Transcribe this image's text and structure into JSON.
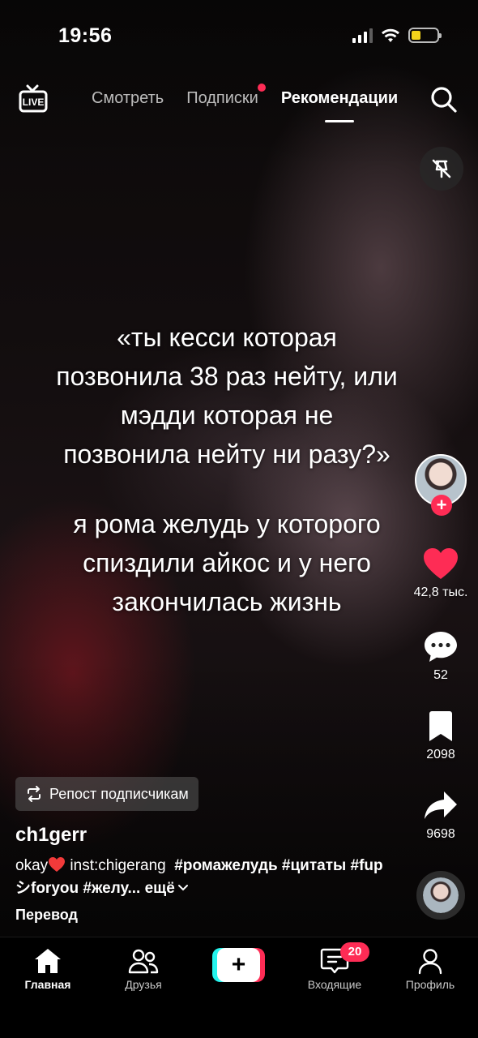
{
  "status_bar": {
    "time": "19:56"
  },
  "top_nav": {
    "tabs": [
      {
        "label": "Смотреть"
      },
      {
        "label": "Подписки"
      },
      {
        "label": "Рекомендации"
      }
    ]
  },
  "video": {
    "caption_lines": [
      "«ты кесси которая",
      "позвонила 38 раз нейту, или",
      "мэдди которая не",
      "позвонила нейту ни разу?»",
      "я рома желудь у которого",
      "спиздили айкос и у него",
      "закончилась жизнь"
    ]
  },
  "actions": {
    "likes": "42,8 тыс.",
    "comments": "52",
    "saves": "2098",
    "shares": "9698"
  },
  "post": {
    "repost_label": "Репост подписчикам",
    "username": "ch1gerr",
    "desc_okay": "okay",
    "desc_inst": "inst:chigerang",
    "tags": [
      "#ромажелудь",
      "#цитаты",
      "#fupシforyou",
      "#желу..."
    ],
    "more_label": "ещё",
    "translate_label": "Перевод"
  },
  "tab_bar": {
    "home": "Главная",
    "friends": "Друзья",
    "inbox": "Входящие",
    "inbox_badge": "20",
    "profile": "Профиль"
  },
  "colors": {
    "accent_red": "#fe2c55",
    "accent_cyan": "#25f4ee",
    "battery": "#f2d21b"
  }
}
